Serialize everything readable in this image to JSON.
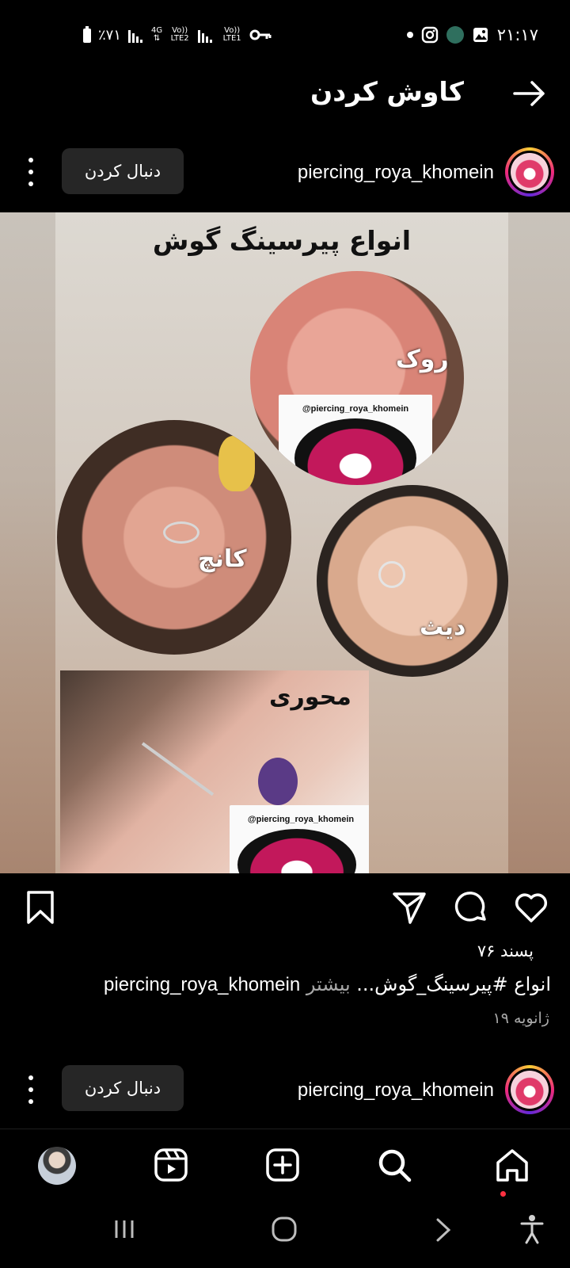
{
  "status_bar": {
    "time": "۲۱:۱۷",
    "battery": "٪۷۱",
    "network_1": "4G",
    "lte2": "Vo)) LTE2",
    "lte1": "Vo)) LTE1",
    "icons": [
      "battery-icon",
      "signal-icon",
      "key-icon",
      "dot-icon",
      "instagram-icon",
      "app-icon",
      "gallery-icon"
    ]
  },
  "header": {
    "title": "کاوش کردن",
    "back_icon": "arrow-right-icon"
  },
  "post": {
    "username": "piercing_roya_khomein",
    "follow_label": "دنبال کردن",
    "image": {
      "title": "انواع پیرسینگ گوش",
      "label_rook": "روک",
      "label_conch": "کانچ",
      "label_daith": "دیث",
      "label_industrial": "محوری",
      "card_handle": "@piercing_roya_khomein",
      "card_handle_2": "@piercing_roya_khomein"
    },
    "likes": "۷۶ پسند",
    "caption_user": "piercing_roya_khomein",
    "caption_text": "انواع #پیرسینگ_گوش...",
    "caption_more": "بیشتر",
    "date": "۱۹ ژانویه"
  },
  "next_post": {
    "username": "piercing_roya_khomein",
    "follow_label": "دنبال کردن"
  },
  "colors": {
    "background": "#000000",
    "button_bg": "#262626",
    "muted_text": "#a8a8a8",
    "notification": "#ff3040"
  }
}
